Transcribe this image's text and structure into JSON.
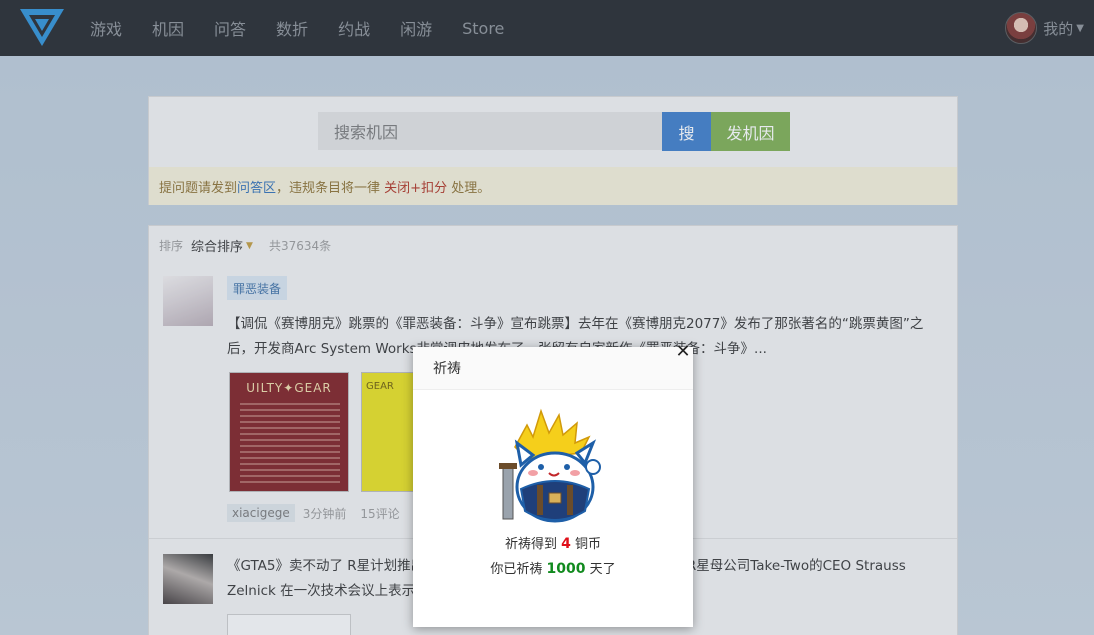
{
  "nav": {
    "links": [
      "游戏",
      "机因",
      "问答",
      "数折",
      "约战",
      "闲游",
      "Store"
    ],
    "user_label": "我的"
  },
  "search": {
    "placeholder": "搜索机因",
    "search_label": "搜",
    "post_label": "发机因"
  },
  "notice": {
    "prefix": "提问题请发到",
    "link": "问答区",
    "middle": "，违规条目将一律 ",
    "warn": "关闭+扣分",
    "suffix": " 处理。"
  },
  "list": {
    "sort_label": "排序",
    "sort_value": "综合排序",
    "count": "共37634条",
    "posts": [
      {
        "tag": "罪恶装备",
        "text": "【调侃《赛博朋克》跳票的《罪恶装备：斗争》宣布跳票】去年在《赛博朋克2077》发布了那张著名的“跳票黄图”之后，开发商Arc System Works非常调皮地发布了一张留有自家新作《罪恶装备：斗争》...",
        "thumb1_title": "UILTY✦GEAR",
        "thumb2_title": "GEAR",
        "user": "xiacigege",
        "time": "3分钟前",
        "comments": "15评论"
      },
      {
        "text": "《GTA5》卖不动了 R星计划推出新作？近日，根据外媒报道，《GTA》开发商R星母公司Take-Two的CEO Strauss Zelnick 在一次技术会议上表示，新作将会发售。部分原因是..."
      }
    ]
  },
  "modal": {
    "title": "祈祷",
    "line1_prefix": "祈祷得到 ",
    "coins": "4",
    "line1_suffix": " 铜币",
    "line2_prefix": "你已祈祷 ",
    "days": "1000",
    "line2_suffix": " 天了"
  },
  "colors": {
    "nav_bg": "#1f2328",
    "search_button": "#3a7bc8",
    "post_button": "#7cad4e",
    "coins_red": "#e0101a",
    "days_green": "#118a1e"
  }
}
